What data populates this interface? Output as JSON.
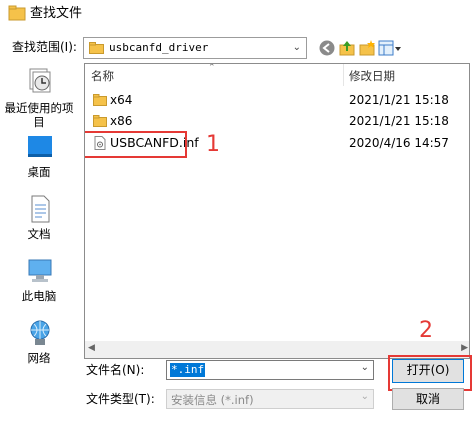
{
  "window": {
    "title": "查找文件"
  },
  "lookin": {
    "label": "查找范围(I):",
    "value": "usbcanfd_driver"
  },
  "nav": {
    "items": [
      {
        "label": "最近使用的项目"
      },
      {
        "label": "桌面"
      },
      {
        "label": "文档"
      },
      {
        "label": "此电脑"
      },
      {
        "label": "网络"
      }
    ]
  },
  "list": {
    "columns": {
      "name": "名称",
      "modified": "修改日期"
    },
    "rows": [
      {
        "name": "x64",
        "date": "2021/1/21 15:18",
        "type": "folder"
      },
      {
        "name": "x86",
        "date": "2021/1/21 15:18",
        "type": "folder"
      },
      {
        "name": "USBCANFD.inf",
        "date": "2020/4/16 14:57",
        "type": "file"
      }
    ]
  },
  "annotations": {
    "step1": "1",
    "step2": "2",
    "color": "#e53935"
  },
  "form": {
    "filename_label": "文件名(N):",
    "filename_value": "*.inf",
    "filetype_label": "文件类型(T):",
    "filetype_value": "安装信息 (*.inf)"
  },
  "buttons": {
    "open": "打开(O)",
    "cancel": "取消"
  },
  "colors": {
    "selection": "#0078d7",
    "folder": "#f5c24a",
    "accent_blue": "#1e88e5"
  }
}
